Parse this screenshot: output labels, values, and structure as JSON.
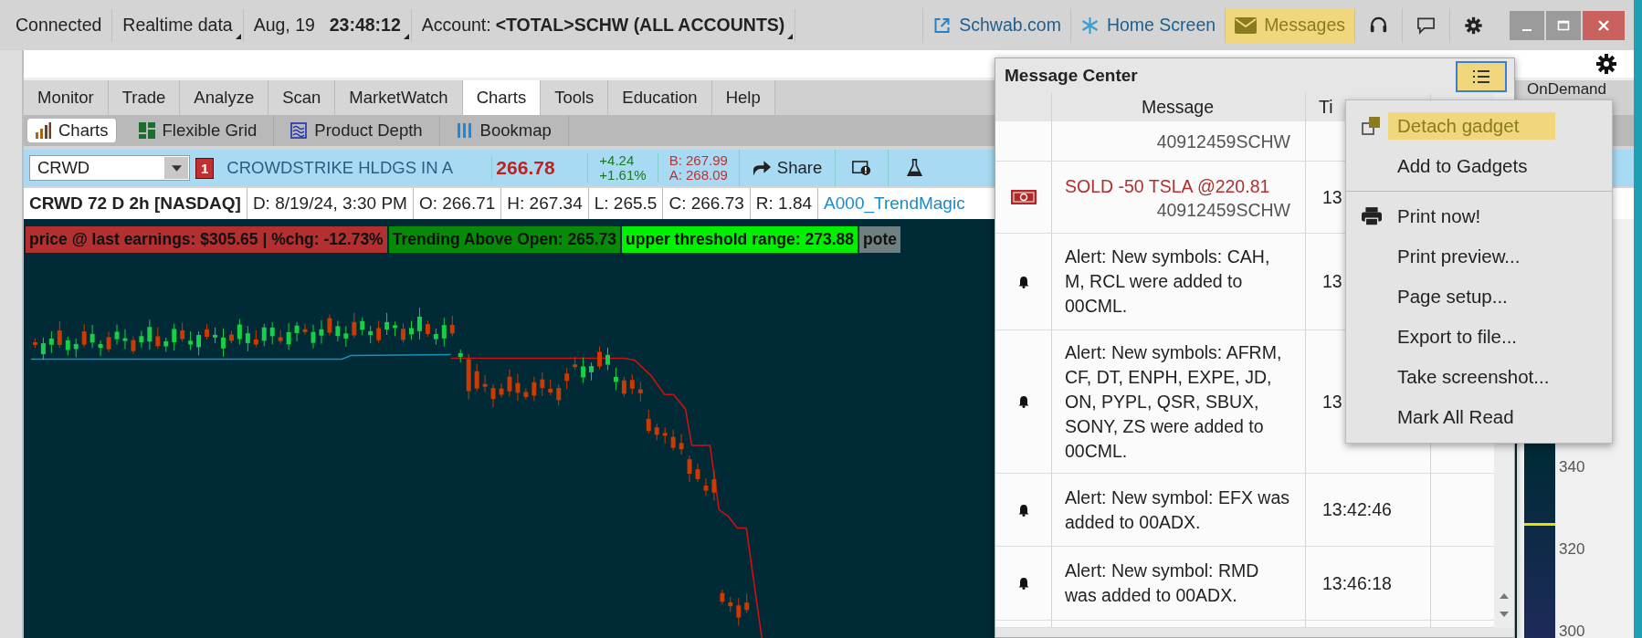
{
  "top_bar": {
    "connection": "Connected",
    "feed": "Realtime data",
    "date": "Aug, 19",
    "time": "23:48:12",
    "account_label": "Account:",
    "account": "<TOTAL>SCHW (ALL ACCOUNTS)",
    "links": [
      {
        "kind": "external",
        "label": "Schwab.com",
        "selected": false
      },
      {
        "kind": "home",
        "label": "Home Screen",
        "selected": false
      },
      {
        "kind": "messages",
        "label": "Messages",
        "selected": true
      }
    ],
    "tools": [
      {
        "kind": "support"
      },
      {
        "kind": "chat"
      },
      {
        "kind": "settings"
      }
    ]
  },
  "main_tabs": [
    {
      "label": "Monitor",
      "selected": false
    },
    {
      "label": "Trade",
      "selected": false
    },
    {
      "label": "Analyze",
      "selected": false
    },
    {
      "label": "Scan",
      "selected": false
    },
    {
      "label": "MarketWatch",
      "selected": false
    },
    {
      "label": "Charts",
      "selected": true
    },
    {
      "label": "Tools",
      "selected": false
    },
    {
      "label": "Education",
      "selected": false
    },
    {
      "label": "Help",
      "selected": false
    }
  ],
  "ondemand": "OnDemand",
  "sub_tabs": [
    {
      "kind": "bars",
      "label": "Charts",
      "selected": true
    },
    {
      "kind": "grid",
      "label": "Flexible Grid",
      "selected": false
    },
    {
      "kind": "depth",
      "label": "Product Depth",
      "selected": false
    },
    {
      "kind": "bookmap",
      "label": "Bookmap",
      "selected": false
    }
  ],
  "symbol_bar": {
    "symbol": "CRWD",
    "alert_count": "1",
    "description": "CROWDSTRIKE HLDGS IN A",
    "last": "266.78",
    "change": "+4.24",
    "change_pct": "+1.61%",
    "bid": "B: 267.99",
    "ask": "A: 268.09",
    "share": "Share"
  },
  "chart_header": {
    "title": "CRWD 72 D 2h [NASDAQ]",
    "fields": [
      "D: 8/19/24, 3:30 PM",
      "O: 266.71",
      "H: 267.34",
      "L: 265.5",
      "C: 266.73",
      "R: 1.84"
    ],
    "study": "A000_TrendMagic"
  },
  "labels": [
    {
      "text": "price @ last earnings: $305.65 | %chg: -12.73%",
      "color": "#b23030"
    },
    {
      "text": "Trending Above Open: 265.73",
      "color": "#078a07"
    },
    {
      "text": "upper threshold range: 273.88",
      "color": "#00f000"
    },
    {
      "text": "pote",
      "color": "#6f8080"
    }
  ],
  "price_axis": [
    "340",
    "320",
    "300"
  ],
  "message_center": {
    "title": "Message Center",
    "menu_open": true,
    "columns": [
      "Message",
      "Ti"
    ],
    "rows": [
      {
        "kind": "none",
        "account": "40912459SCHW"
      },
      {
        "kind": "order",
        "text": "SOLD -50 TSLA @220.81",
        "account": "40912459SCHW",
        "time": "13"
      },
      {
        "kind": "alert",
        "text": "Alert: New symbols: CAH, M, RCL were added to 00CML.",
        "time": "13"
      },
      {
        "kind": "alert",
        "text": "Alert: New symbols: AFRM, CF, DT, ENPH, EXPE, JD, ON, PYPL, QSR, SBUX, SONY, ZS were added to 00CML.",
        "time": "13"
      },
      {
        "kind": "alert",
        "text": "Alert: New symbol: EFX was added to 00ADX.",
        "time": "13:42:46"
      },
      {
        "kind": "alert",
        "text": "Alert: New symbol: RMD was added to 00ADX.",
        "time": "13:46:18"
      }
    ]
  },
  "menu": {
    "items": [
      {
        "kind": "detach",
        "label": "Detach gadget",
        "selected": true
      },
      {
        "kind": "plain",
        "label": "Add to Gadgets",
        "selected": false
      },
      {
        "kind": "divider"
      },
      {
        "kind": "print",
        "label": "Print now!",
        "selected": false
      },
      {
        "kind": "plain",
        "label": "Print preview...",
        "selected": false
      },
      {
        "kind": "plain",
        "label": "Page setup...",
        "selected": false
      },
      {
        "kind": "plain",
        "label": "Export to file...",
        "selected": false
      },
      {
        "kind": "plain",
        "label": "Take screenshot...",
        "selected": false
      },
      {
        "kind": "plain",
        "label": "Mark All Read",
        "selected": false
      }
    ]
  }
}
